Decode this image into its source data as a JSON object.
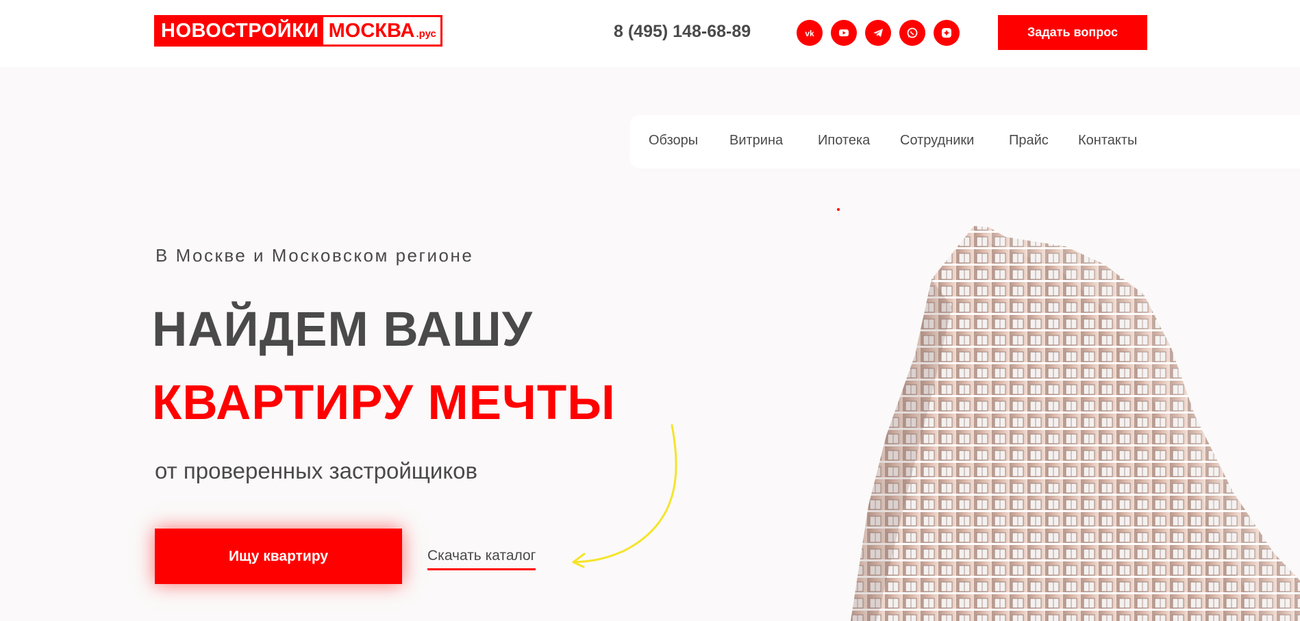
{
  "header": {
    "logo_left": "НОВОСТРОЙКИ",
    "logo_right": "МОСКВА",
    "logo_suffix": ".рус",
    "phone": "8 (495) 148-68-89",
    "socials": [
      {
        "name": "vk-icon"
      },
      {
        "name": "youtube-icon"
      },
      {
        "name": "telegram-icon"
      },
      {
        "name": "whatsapp-icon"
      },
      {
        "name": "zen-icon"
      }
    ],
    "ask_button": "Задать вопрос"
  },
  "nav": {
    "items": [
      "Обзоры",
      "Витрина",
      "Ипотека",
      "Сотрудники",
      "Прайс",
      "Контакты"
    ]
  },
  "hero": {
    "subtitle": "В Москве и Московском регионе",
    "headline_line1": "НАЙДЕМ ВАШУ",
    "headline_line2": "КВАРТИРУ МЕЧТЫ",
    "tagline": "от проверенных застройщиков",
    "cta_button": "Ищу квартиру",
    "catalog_link": "Скачать каталог"
  },
  "colors": {
    "accent": "#ff0000",
    "text": "#4a4a4a",
    "background": "#fbf9f9",
    "arrow": "#f5e42a"
  }
}
